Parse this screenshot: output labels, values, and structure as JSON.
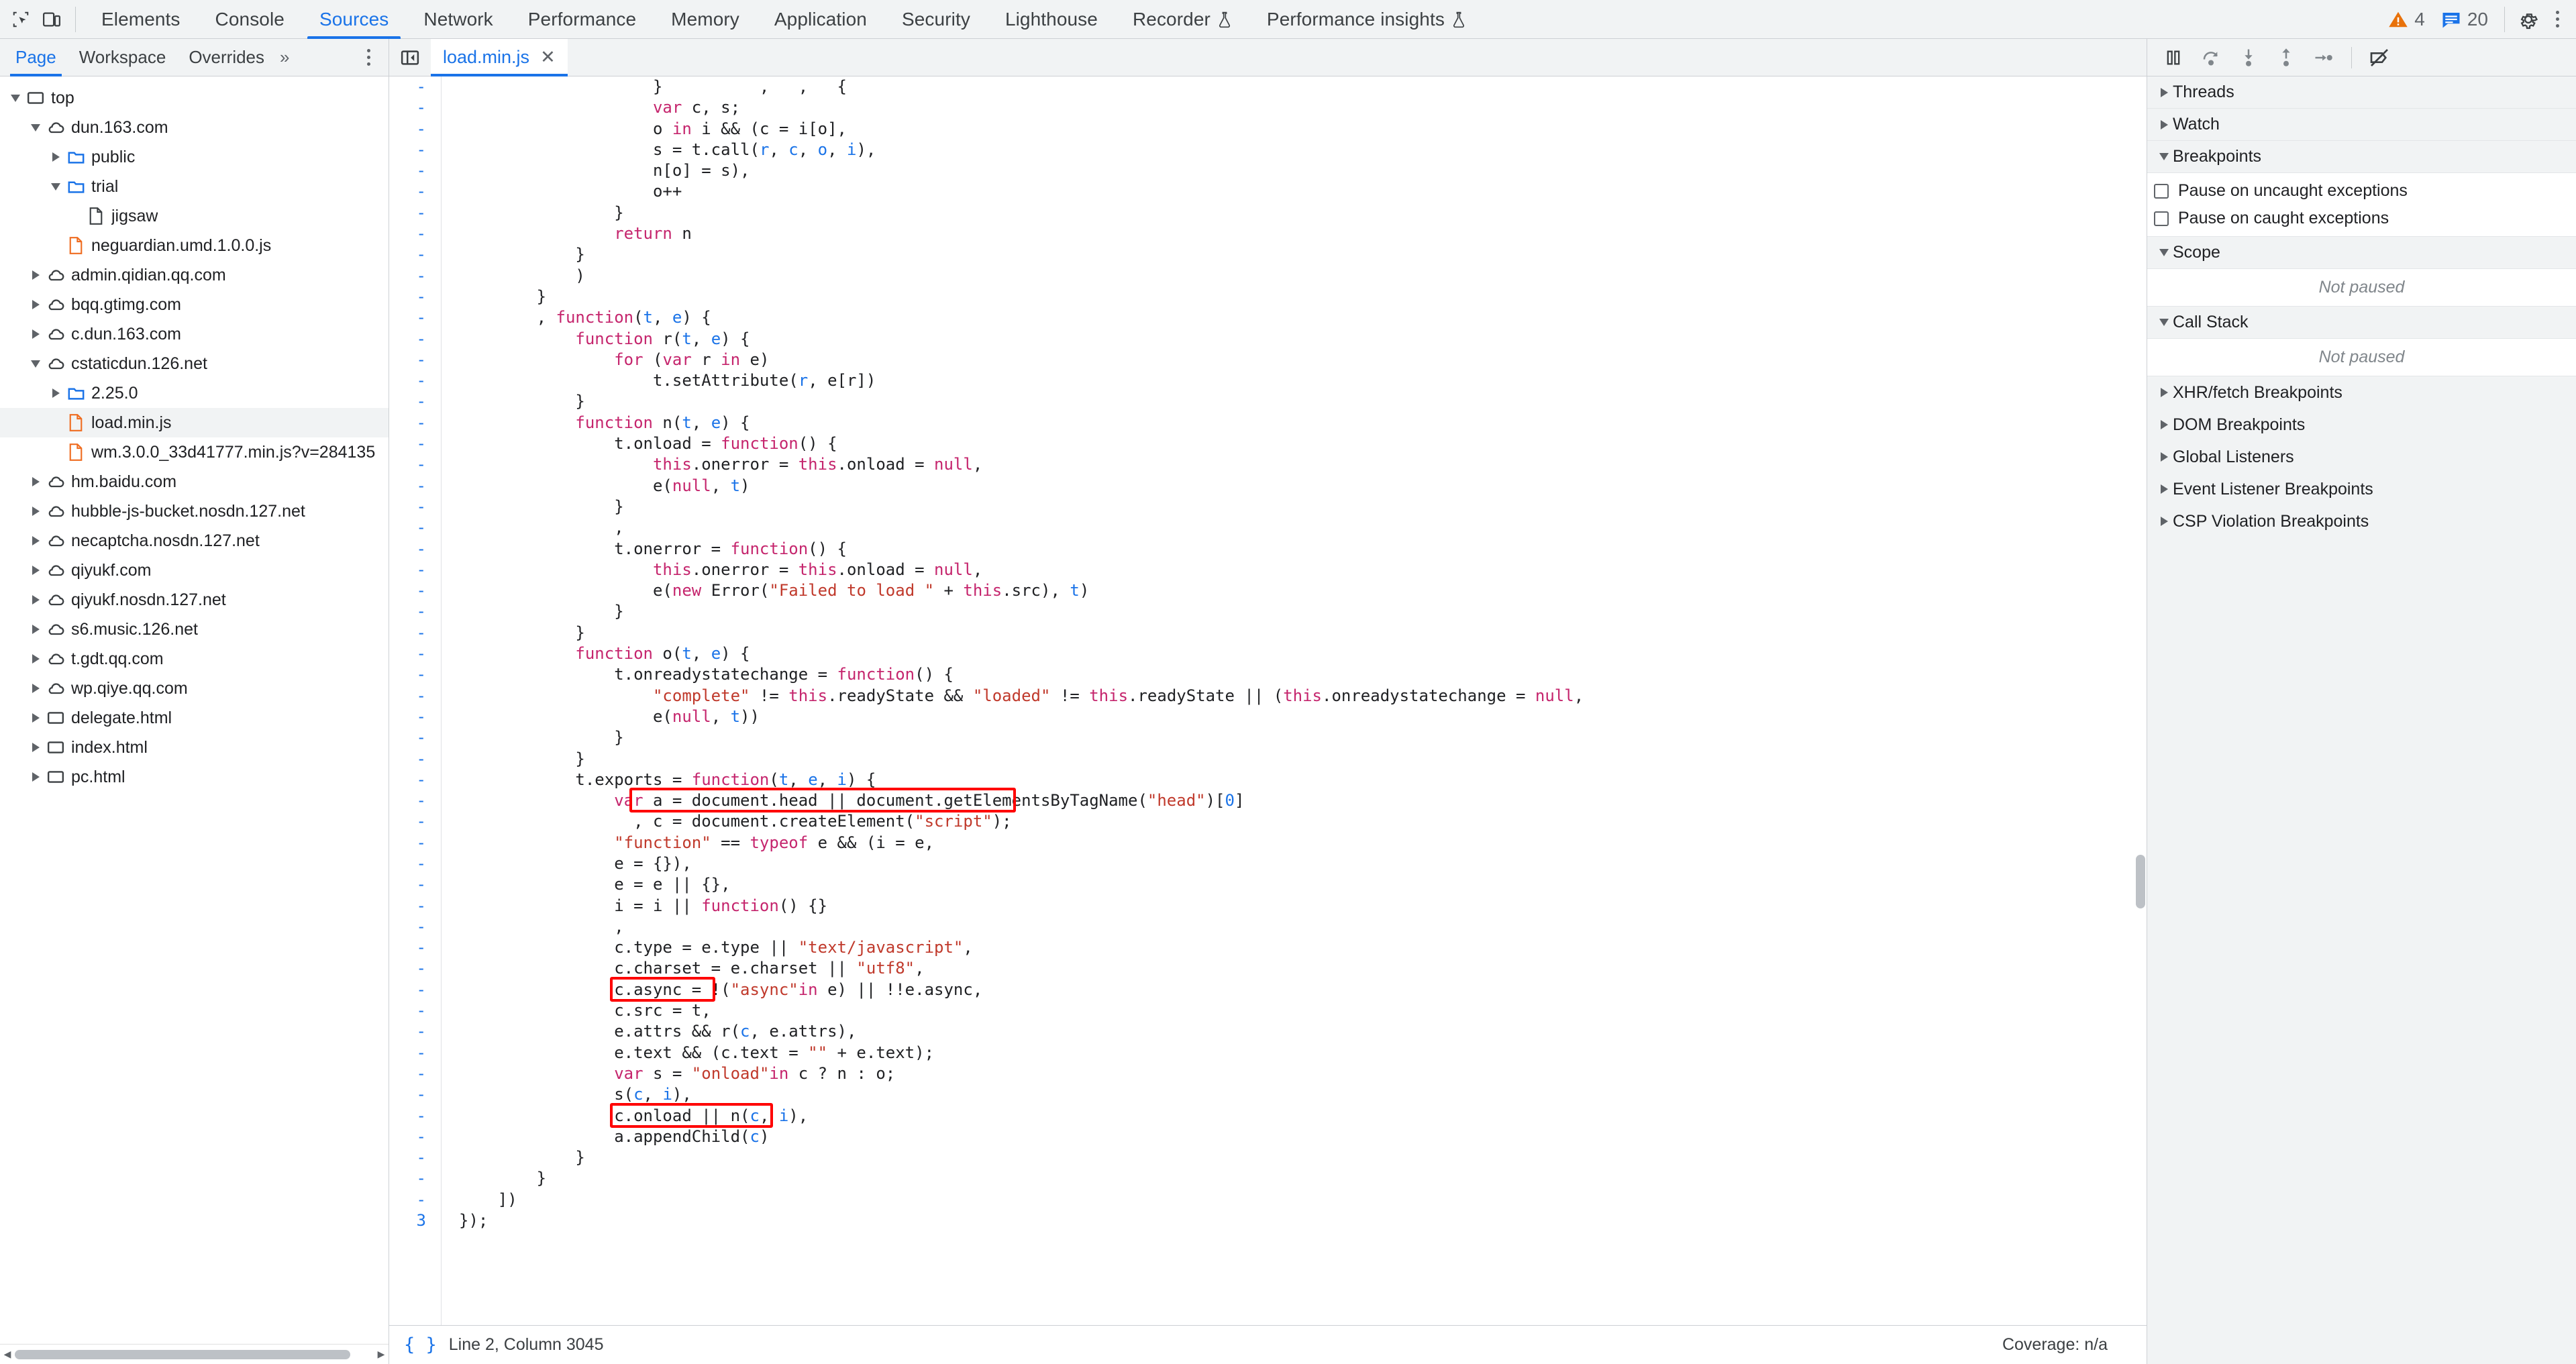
{
  "toolbar": {
    "inspect_icon": "inspect-element-icon",
    "device_icon": "device-toolbar-icon",
    "tabs": [
      {
        "label": "Elements",
        "active": false,
        "flask": false
      },
      {
        "label": "Console",
        "active": false,
        "flask": false
      },
      {
        "label": "Sources",
        "active": true,
        "flask": false
      },
      {
        "label": "Network",
        "active": false,
        "flask": false
      },
      {
        "label": "Performance",
        "active": false,
        "flask": false
      },
      {
        "label": "Memory",
        "active": false,
        "flask": false
      },
      {
        "label": "Application",
        "active": false,
        "flask": false
      },
      {
        "label": "Security",
        "active": false,
        "flask": false
      },
      {
        "label": "Lighthouse",
        "active": false,
        "flask": false
      },
      {
        "label": "Recorder",
        "active": false,
        "flask": true
      },
      {
        "label": "Performance insights",
        "active": false,
        "flask": true
      }
    ],
    "warning_count": "4",
    "message_count": "20",
    "warning_color": "#e8710a",
    "message_color": "#1a73e8",
    "settings_icon": "gear-icon",
    "more_icon": "more-options-icon"
  },
  "navigator": {
    "tabs": [
      {
        "label": "Page",
        "active": true
      },
      {
        "label": "Workspace",
        "active": false
      },
      {
        "label": "Overrides",
        "active": false
      }
    ],
    "more_tabs_label": "»",
    "more_icon": "more-options-icon",
    "tree": [
      {
        "label": "top",
        "icon": "frame-icon",
        "twisty": "down",
        "indent": 0,
        "selected": false
      },
      {
        "label": "dun.163.com",
        "icon": "cloud-icon",
        "twisty": "down",
        "indent": 1,
        "selected": false
      },
      {
        "label": "public",
        "icon": "folder-icon",
        "twisty": "right",
        "indent": 2,
        "selected": false
      },
      {
        "label": "trial",
        "icon": "folder-icon",
        "twisty": "down",
        "indent": 2,
        "selected": false
      },
      {
        "label": "jigsaw",
        "icon": "document-icon",
        "twisty": "none",
        "indent": 3,
        "selected": false
      },
      {
        "label": "neguardian.umd.1.0.0.js",
        "icon": "js-file-icon",
        "twisty": "none",
        "indent": 2,
        "selected": false
      },
      {
        "label": "admin.qidian.qq.com",
        "icon": "cloud-icon",
        "twisty": "right",
        "indent": 1,
        "selected": false
      },
      {
        "label": "bqq.gtimg.com",
        "icon": "cloud-icon",
        "twisty": "right",
        "indent": 1,
        "selected": false
      },
      {
        "label": "c.dun.163.com",
        "icon": "cloud-icon",
        "twisty": "right",
        "indent": 1,
        "selected": false
      },
      {
        "label": "cstaticdun.126.net",
        "icon": "cloud-icon",
        "twisty": "down",
        "indent": 1,
        "selected": false
      },
      {
        "label": "2.25.0",
        "icon": "folder-icon",
        "twisty": "right",
        "indent": 2,
        "selected": false
      },
      {
        "label": "load.min.js",
        "icon": "js-file-icon",
        "twisty": "none",
        "indent": 2,
        "selected": true
      },
      {
        "label": "wm.3.0.0_33d41777.min.js?v=284135",
        "icon": "js-file-icon",
        "twisty": "none",
        "indent": 2,
        "selected": false
      },
      {
        "label": "hm.baidu.com",
        "icon": "cloud-icon",
        "twisty": "right",
        "indent": 1,
        "selected": false
      },
      {
        "label": "hubble-js-bucket.nosdn.127.net",
        "icon": "cloud-icon",
        "twisty": "right",
        "indent": 1,
        "selected": false
      },
      {
        "label": "necaptcha.nosdn.127.net",
        "icon": "cloud-icon",
        "twisty": "right",
        "indent": 1,
        "selected": false
      },
      {
        "label": "qiyukf.com",
        "icon": "cloud-icon",
        "twisty": "right",
        "indent": 1,
        "selected": false
      },
      {
        "label": "qiyukf.nosdn.127.net",
        "icon": "cloud-icon",
        "twisty": "right",
        "indent": 1,
        "selected": false
      },
      {
        "label": "s6.music.126.net",
        "icon": "cloud-icon",
        "twisty": "right",
        "indent": 1,
        "selected": false
      },
      {
        "label": "t.gdt.qq.com",
        "icon": "cloud-icon",
        "twisty": "right",
        "indent": 1,
        "selected": false
      },
      {
        "label": "wp.qiye.qq.com",
        "icon": "cloud-icon",
        "twisty": "right",
        "indent": 1,
        "selected": false
      },
      {
        "label": "delegate.html",
        "icon": "frame-icon",
        "twisty": "right",
        "indent": 1,
        "selected": false
      },
      {
        "label": "index.html",
        "icon": "frame-icon",
        "twisty": "right",
        "indent": 1,
        "selected": false
      },
      {
        "label": "pc.html",
        "icon": "frame-icon",
        "twisty": "right",
        "indent": 1,
        "selected": false
      }
    ]
  },
  "editor": {
    "panel_toggle_icon": "show-navigator-icon",
    "open_file": "load.min.js",
    "close_label": "✕",
    "gutter_marks": [
      "-",
      "-",
      "-",
      "-",
      "-",
      "-",
      "-",
      "-",
      "-",
      "-",
      "-",
      "-",
      "-",
      "-",
      "-",
      "-",
      "-",
      "-",
      "-",
      "-",
      "-",
      "-",
      "-",
      "-",
      "-",
      "-",
      "-",
      "-",
      "-",
      "-",
      "-",
      "-",
      "-",
      "-",
      "-",
      "-",
      "-",
      "-",
      "-",
      "-",
      "-",
      "-",
      "-",
      "-",
      "-",
      "-",
      "-",
      "-",
      "-",
      "-",
      "-",
      "-",
      "-",
      "-",
      "3"
    ],
    "lines": [
      "                    }          ,   ,   {",
      "                    var c, s;",
      "                    o in i && (c = i[o],",
      "                    s = t.call(r, c, o, i),",
      "                    n[o] = s),",
      "                    o++",
      "                }",
      "                return n",
      "            }",
      "            )",
      "        }",
      "        , function(t, e) {",
      "            function r(t, e) {",
      "                for (var r in e)",
      "                    t.setAttribute(r, e[r])",
      "            }",
      "            function n(t, e) {",
      "                t.onload = function() {",
      "                    this.onerror = this.onload = null,",
      "                    e(null, t)",
      "                }",
      "                ,",
      "                t.onerror = function() {",
      "                    this.onerror = this.onload = null,",
      "                    e(new Error(\"Failed to load \" + this.src), t)",
      "                }",
      "            }",
      "            function o(t, e) {",
      "                t.onreadystatechange = function() {",
      "                    \"complete\" != this.readyState && \"loaded\" != this.readyState || (this.onreadystatechange = null,",
      "                    e(null, t))",
      "                }",
      "            }",
      "            t.exports = function(t, e, i) {",
      "                var a = document.head || document.getElementsByTagName(\"head\")[0]",
      "                  , c = document.createElement(\"script\");",
      "                \"function\" == typeof e && (i = e,",
      "                e = {}),",
      "                e = e || {},",
      "                i = i || function() {}",
      "                ,",
      "                c.type = e.type || \"text/javascript\",",
      "                c.charset = e.charset || \"utf8\",",
      "                c.async = !(\"async\"in e) || !!e.async,",
      "                c.src = t,",
      "                e.attrs && r(c, e.attrs),",
      "                e.text && (c.text = \"\" + e.text);",
      "                var s = \"onload\"in c ? n : o;",
      "                s(c, i),",
      "                c.onload || n(c, i),",
      "                a.appendChild(c)",
      "            }",
      "        }",
      "    ])",
      "});",
      ""
    ],
    "highlights": [
      {
        "name": "create-element-highlight",
        "code": ", c = document.createElement(\"script\");"
      },
      {
        "name": "src-assign-highlight",
        "code": "c.src = t,"
      },
      {
        "name": "append-child-highlight",
        "code": "a.appendChild(c)"
      }
    ],
    "status": {
      "format_icon": "pretty-print-icon",
      "position": "Line 2, Column 3045",
      "coverage": "Coverage: n/a"
    }
  },
  "debugger": {
    "controls": [
      {
        "name": "pause-script-execution-button",
        "icon": "pause-icon"
      },
      {
        "name": "step-over-button",
        "icon": "step-over-icon"
      },
      {
        "name": "step-into-button",
        "icon": "step-into-icon"
      },
      {
        "name": "step-out-button",
        "icon": "step-out-icon"
      },
      {
        "name": "step-button",
        "icon": "step-icon"
      },
      {
        "name": "deactivate-breakpoints-button",
        "icon": "deactivate-breakpoints-icon"
      }
    ],
    "sections": [
      {
        "label": "Threads",
        "expanded": false
      },
      {
        "label": "Watch",
        "expanded": false
      },
      {
        "label": "Breakpoints",
        "expanded": true
      },
      {
        "label": "Scope",
        "expanded": true
      },
      {
        "label": "Call Stack",
        "expanded": true
      },
      {
        "label": "XHR/fetch Breakpoints",
        "expanded": false
      },
      {
        "label": "DOM Breakpoints",
        "expanded": false
      },
      {
        "label": "Global Listeners",
        "expanded": false
      },
      {
        "label": "Event Listener Breakpoints",
        "expanded": false
      },
      {
        "label": "CSP Violation Breakpoints",
        "expanded": false
      }
    ],
    "breakpoint_options": [
      {
        "label": "Pause on uncaught exceptions",
        "checked": false
      },
      {
        "label": "Pause on caught exceptions",
        "checked": false
      }
    ],
    "scope_empty": "Not paused",
    "callstack_empty": "Not paused"
  }
}
